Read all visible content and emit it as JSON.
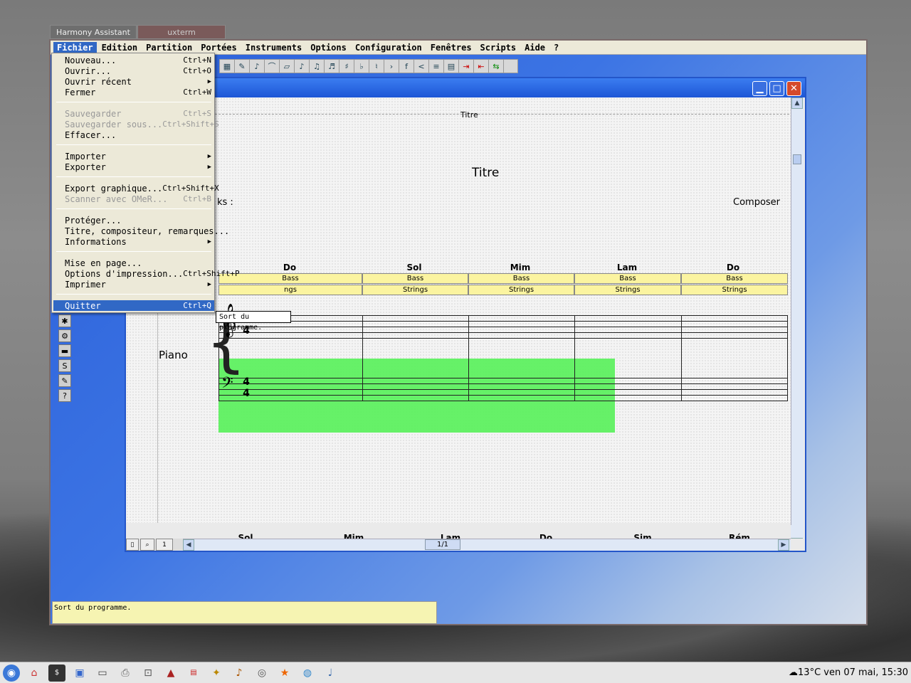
{
  "desktop_tabs": [
    "Harmony Assistant",
    "uxterm"
  ],
  "menubar": [
    "Fichier",
    "Edition",
    "Partition",
    "Portées",
    "Instruments",
    "Options",
    "Configuration",
    "Fenêtres",
    "Scripts",
    "Aide",
    "?"
  ],
  "file_menu": {
    "items": [
      {
        "label": "Nouveau...",
        "shortcut": "Ctrl+N",
        "state": "enabled"
      },
      {
        "label": "Ouvrir...",
        "shortcut": "Ctrl+O",
        "state": "enabled"
      },
      {
        "label": "Ouvrir récent",
        "shortcut": "",
        "state": "submenu"
      },
      {
        "label": "Fermer",
        "shortcut": "Ctrl+W",
        "state": "enabled"
      },
      {
        "label": "Sauvegarder",
        "shortcut": "Ctrl+S",
        "state": "disabled"
      },
      {
        "label": "Sauvegarder sous...",
        "shortcut": "Ctrl+Shift+S",
        "state": "disabled"
      },
      {
        "label": "Effacer...",
        "shortcut": "",
        "state": "enabled"
      },
      {
        "label": "Importer",
        "shortcut": "",
        "state": "submenu"
      },
      {
        "label": "Exporter",
        "shortcut": "",
        "state": "submenu"
      },
      {
        "label": "Export graphique...",
        "shortcut": "Ctrl+Shift+X",
        "state": "enabled"
      },
      {
        "label": "Scanner avec OMeR...",
        "shortcut": "Ctrl+B",
        "state": "disabled"
      },
      {
        "label": "Protéger...",
        "shortcut": "",
        "state": "enabled"
      },
      {
        "label": "Titre, compositeur, remarques...",
        "shortcut": "",
        "state": "enabled"
      },
      {
        "label": "Informations",
        "shortcut": "",
        "state": "submenu"
      },
      {
        "label": "Mise en page...",
        "shortcut": "",
        "state": "enabled"
      },
      {
        "label": "Options d'impression...",
        "shortcut": "Ctrl+Shift+P",
        "state": "enabled"
      },
      {
        "label": "Imprimer",
        "shortcut": "",
        "state": "submenu"
      },
      {
        "label": "Quitter",
        "shortcut": "Ctrl+Q",
        "state": "highlighted"
      }
    ]
  },
  "tooltip": "Sort du programme.",
  "status_text": "Sort du programme.",
  "score": {
    "header_small": "Titre",
    "title": "Titre",
    "remarks_fragment": "ks :",
    "composer": "Composer",
    "instrument": "Piano",
    "time_signature": "4/4",
    "chords_top": [
      "Do",
      "Sol",
      "Mim",
      "Lam",
      "Do"
    ],
    "bass_row": [
      "Bass",
      "Bass",
      "Bass",
      "Bass",
      "Bass"
    ],
    "strings_row": [
      "ngs",
      "Strings",
      "Strings",
      "Strings",
      "Strings"
    ],
    "chords_bottom": [
      "Sol",
      "Mim",
      "Lam",
      "Do",
      "Sim",
      "Rém"
    ],
    "page_indicator": "1/1",
    "page_box": "1",
    "selection_color": "#5ef060"
  },
  "taskbar": {
    "clock": "13°C ven 07 mai, 15:30"
  }
}
